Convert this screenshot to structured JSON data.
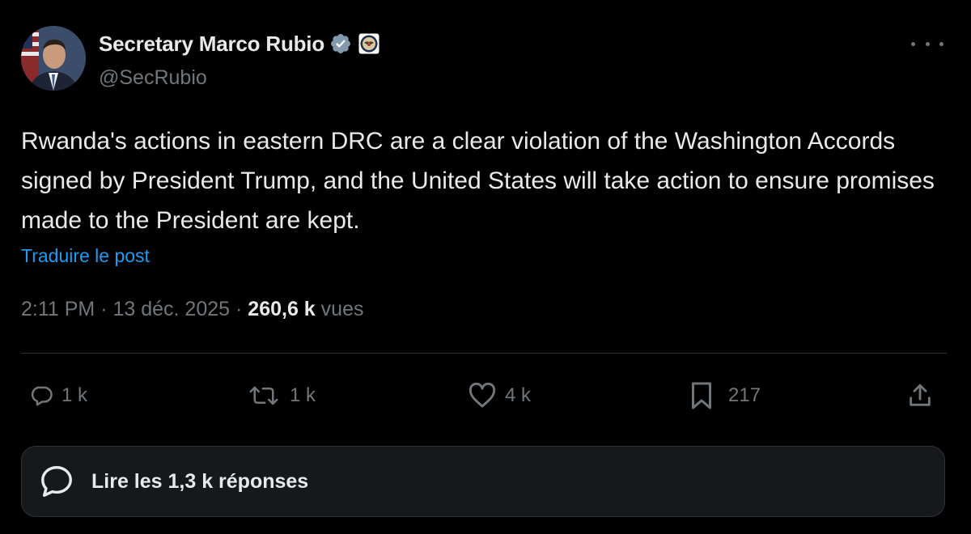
{
  "author": {
    "display_name": "Secretary Marco Rubio",
    "handle": "@SecRubio",
    "verified_badge": "verified-badge-icon",
    "affiliation_badge": "state-department-seal-icon"
  },
  "post": {
    "text": "Rwanda's actions in eastern DRC are a clear violation of the Washington Accords signed by President Trump, and the United States will take action to ensure promises made to the President are kept.",
    "translate_label": "Traduire le post",
    "time": "2:11 PM",
    "separator": "·",
    "date": "13 déc. 2025",
    "views_count": "260,6 k",
    "views_label": "vues"
  },
  "actions": {
    "reply_count": "1 k",
    "repost_count": "1 k",
    "like_count": "4 k",
    "bookmark_count": "217"
  },
  "replies": {
    "label": "Lire les 1,3 k réponses"
  },
  "colors": {
    "background": "#000000",
    "text_primary": "#e7e9ea",
    "text_secondary": "#71767b",
    "link": "#1d9bf0",
    "verified": "#829aab",
    "divider": "#2f3336"
  }
}
